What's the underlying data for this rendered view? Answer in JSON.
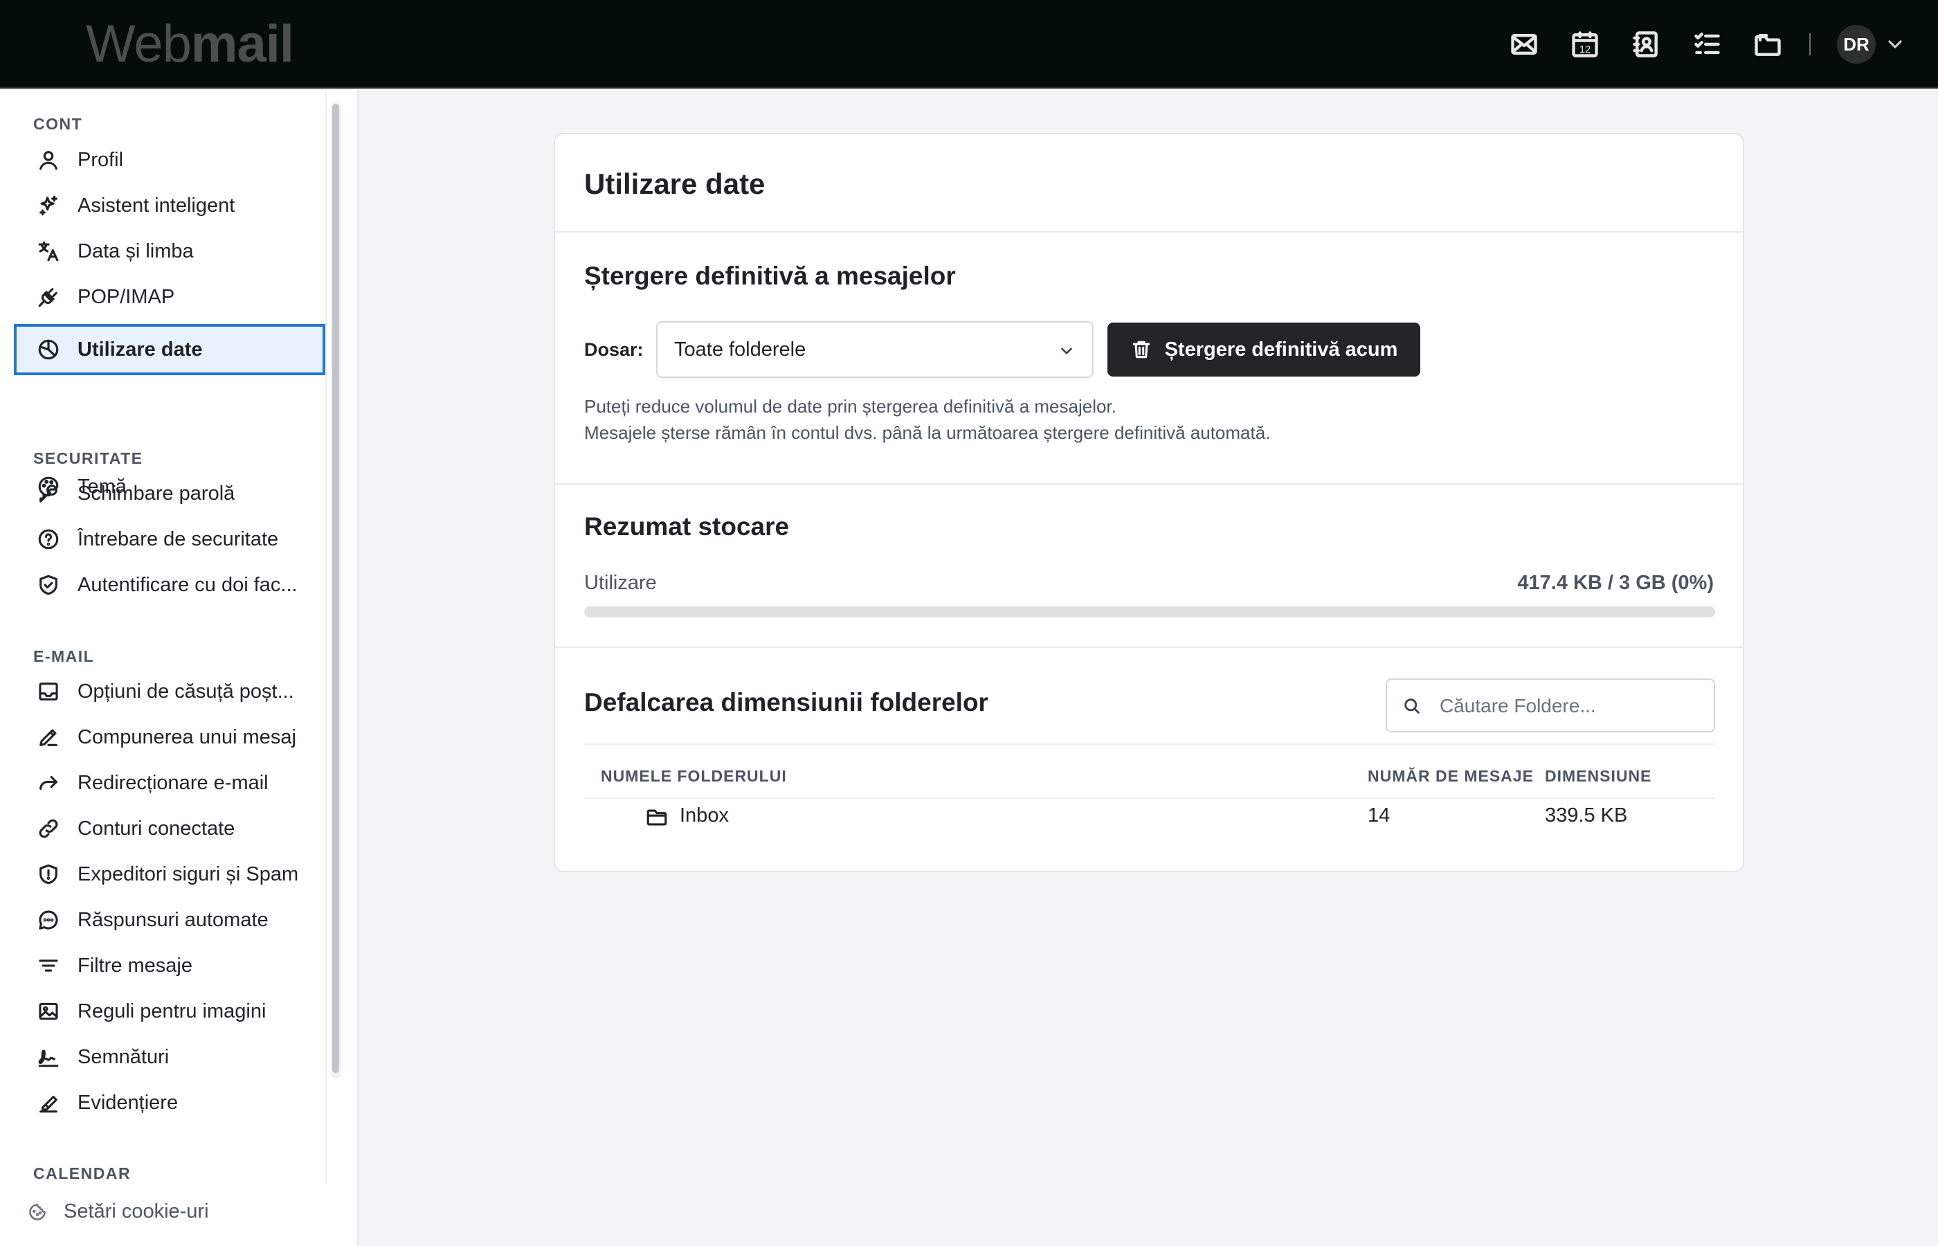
{
  "app": {
    "logo_light": "Web",
    "logo_bold": "mail",
    "avatar_initials": "DR",
    "top_icons": [
      "mail-icon",
      "calendar-icon",
      "contacts-icon",
      "tasks-icon",
      "folder-icon"
    ],
    "calendar_day": "12"
  },
  "sidebar": {
    "sections": [
      {
        "title": "CONT",
        "items": [
          {
            "label": "Profil",
            "icon": "user-icon"
          },
          {
            "label": "Asistent inteligent",
            "icon": "sparkle-icon"
          },
          {
            "label": "Data și limba",
            "icon": "translate-icon"
          },
          {
            "label": "POP/IMAP",
            "icon": "plug-icon"
          },
          {
            "label": "Utilizare date",
            "icon": "pie-chart-icon",
            "active": true
          },
          {
            "label": "Temă",
            "icon": "palette-icon"
          }
        ]
      },
      {
        "title": "SECURITATE",
        "items": [
          {
            "label": "Schimbare parolă",
            "icon": "key-icon"
          },
          {
            "label": "Întrebare de securitate",
            "icon": "question-circle-icon"
          },
          {
            "label": "Autentificare cu doi fac...",
            "icon": "shield-check-icon"
          }
        ]
      },
      {
        "title": "E-MAIL",
        "items": [
          {
            "label": "Opțiuni de căsuță poșt...",
            "icon": "inbox-icon"
          },
          {
            "label": "Compunerea unui mesaj",
            "icon": "pencil-icon"
          },
          {
            "label": "Redirecționare e-mail",
            "icon": "forward-icon"
          },
          {
            "label": "Conturi conectate",
            "icon": "link-icon"
          },
          {
            "label": "Expeditori siguri și Spam",
            "icon": "shield-alert-icon"
          },
          {
            "label": "Răspunsuri automate",
            "icon": "chat-icon"
          },
          {
            "label": "Filtre mesaje",
            "icon": "filter-icon"
          },
          {
            "label": "Reguli pentru imagini",
            "icon": "image-icon"
          },
          {
            "label": "Semnături",
            "icon": "signature-icon"
          },
          {
            "label": "Evidențiere",
            "icon": "highlighter-icon"
          }
        ]
      },
      {
        "title": "CALENDAR",
        "items": []
      }
    ],
    "cookie_label": "Setări cookie-uri"
  },
  "main": {
    "title": "Utilizare date",
    "purge": {
      "title": "Ștergere definitivă a mesajelor",
      "folder_label": "Dosar:",
      "folder_value": "Toate folderele",
      "button_label": "Ștergere definitivă acum",
      "help_line1": "Puteți reduce volumul de date prin ștergerea definitivă a mesajelor.",
      "help_line2": "Mesajele șterse rămân în contul dvs. până la următoarea ștergere definitivă automată."
    },
    "storage": {
      "title": "Rezumat stocare",
      "usage_label": "Utilizare",
      "usage_value": "417.4 KB / 3 GB (0%)",
      "usage_fraction": 0.0
    },
    "breakdown": {
      "title": "Defalcarea dimensiunii folderelor",
      "search_placeholder": "Căutare Foldere...",
      "columns": [
        "NUMELE FOLDERULUI",
        "NUMĂR DE MESAJE",
        "DIMENSIUNE"
      ],
      "rows": [
        {
          "name": "Inbox",
          "count": "14",
          "size": "339.5 KB"
        }
      ]
    }
  }
}
